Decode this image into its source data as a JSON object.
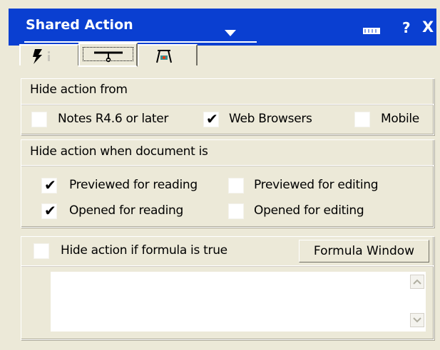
{
  "window": {
    "title": "Shared Action",
    "help_glyph": "?",
    "close_glyph": "X",
    "accent": "#0a3fd1"
  },
  "tabs": [
    {
      "icon": "lightning-icon",
      "selected": false
    },
    {
      "icon": "hide-when-icon",
      "selected": true
    },
    {
      "icon": "advanced-icon",
      "selected": false
    }
  ],
  "hide_from": {
    "heading": "Hide action from",
    "options": [
      {
        "label": "Notes R4.6 or later",
        "checked": false
      },
      {
        "label": "Web Browsers",
        "checked": true
      },
      {
        "label": "Mobile",
        "checked": false
      }
    ]
  },
  "hide_when": {
    "heading": "Hide action when document is",
    "options": [
      {
        "label": "Previewed for reading",
        "checked": true
      },
      {
        "label": "Previewed for editing",
        "checked": false
      },
      {
        "label": "Opened for reading",
        "checked": true
      },
      {
        "label": "Opened for editing",
        "checked": false
      }
    ]
  },
  "formula": {
    "label": "Hide action if formula is true",
    "checked": false,
    "button_label": "Formula Window",
    "value": ""
  },
  "check_glyph": "✔"
}
